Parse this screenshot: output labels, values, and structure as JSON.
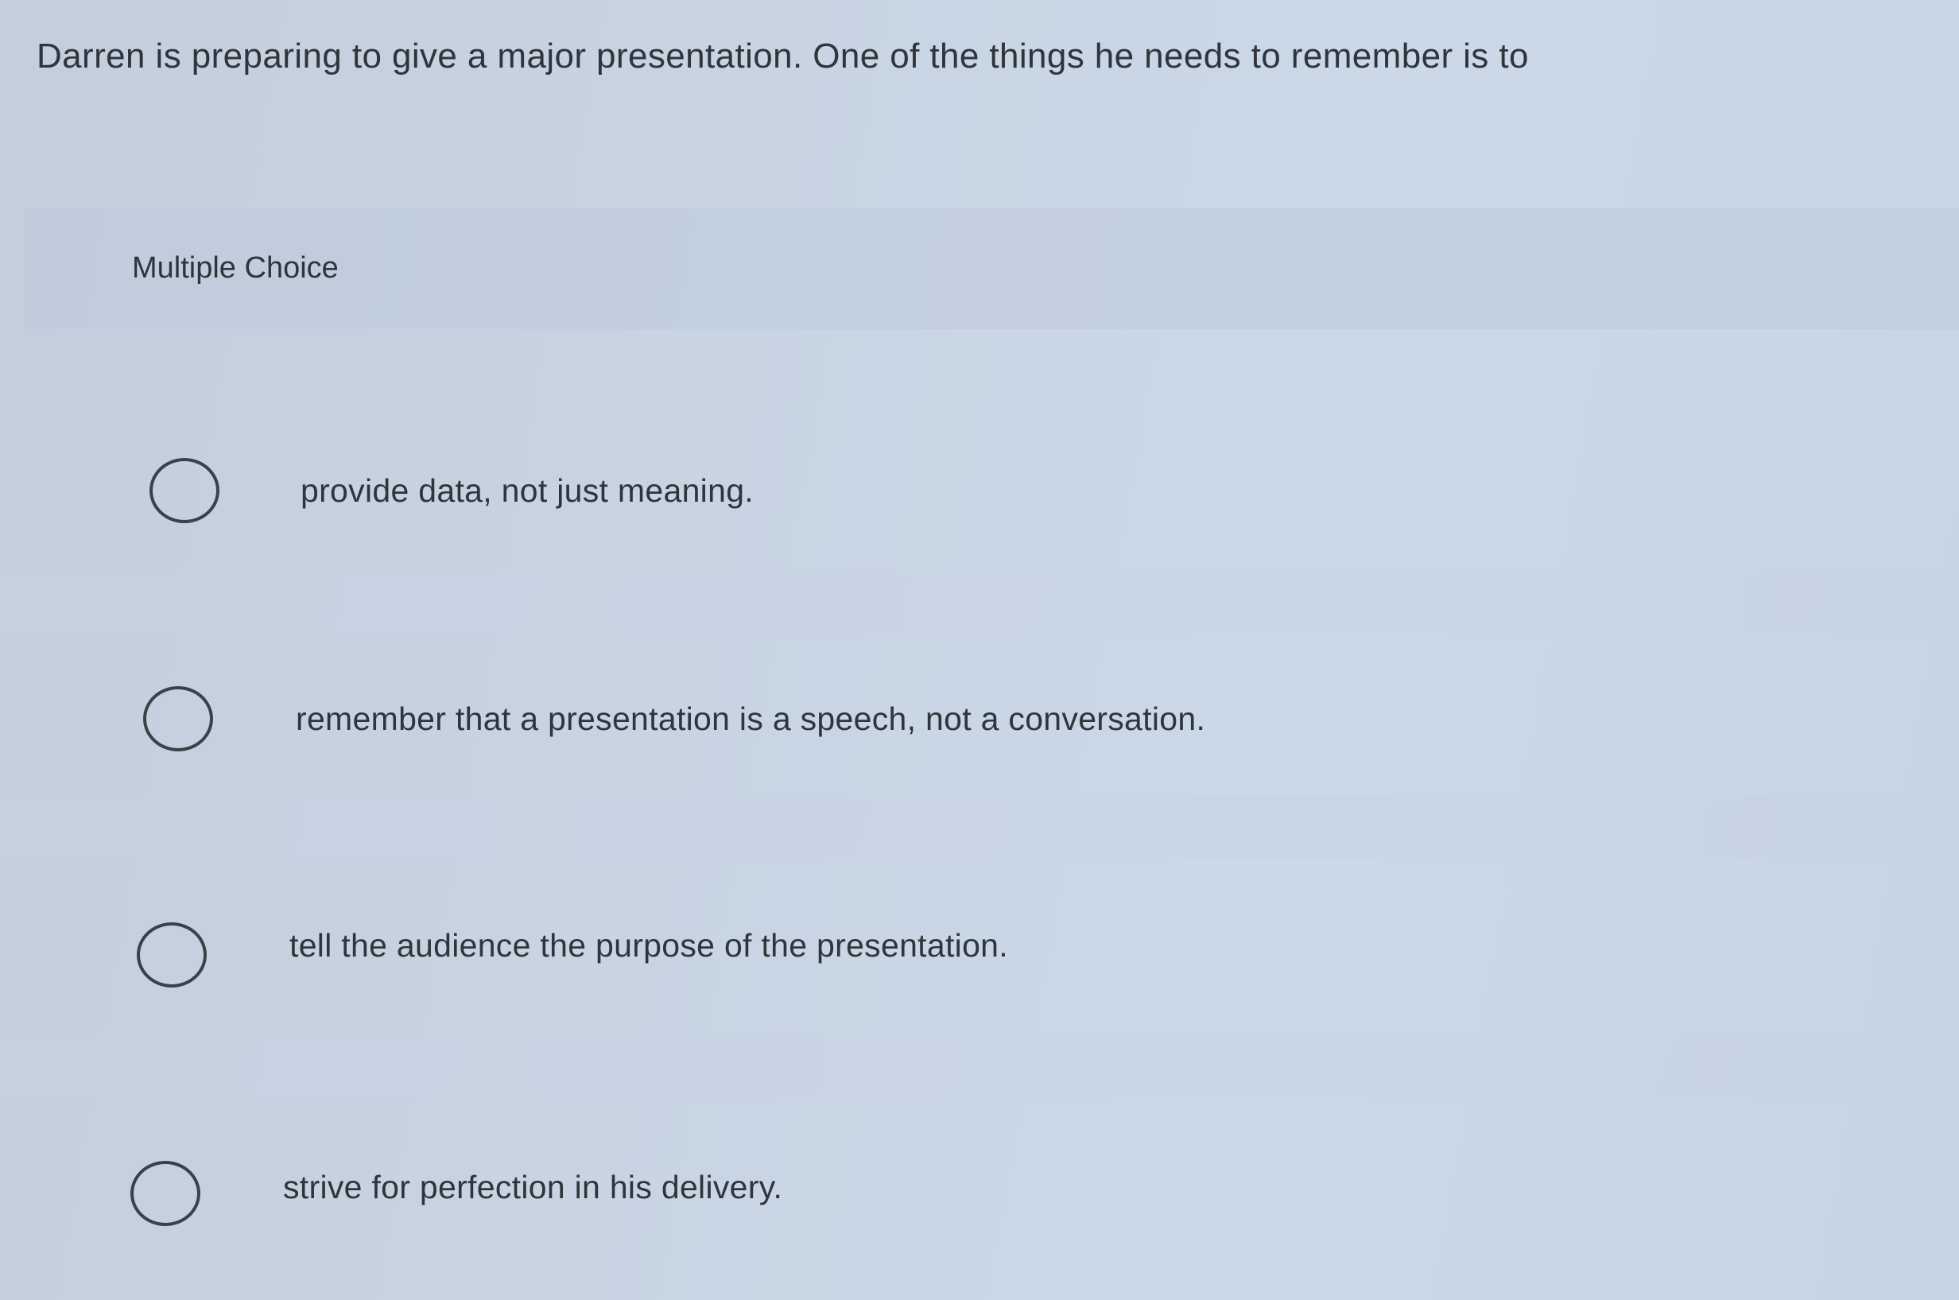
{
  "question": {
    "text": "Darren is preparing to give a major presentation. One of the things he needs to remember is to"
  },
  "question_type": {
    "label": "Multiple Choice"
  },
  "options": [
    {
      "label": "provide data, not just meaning.",
      "selected": false
    },
    {
      "label": "remember that a presentation is a speech, not a conversation.",
      "selected": false
    },
    {
      "label": "tell the audience the purpose of the presentation.",
      "selected": false
    },
    {
      "label": "strive for perfection in his delivery.",
      "selected": false
    }
  ]
}
